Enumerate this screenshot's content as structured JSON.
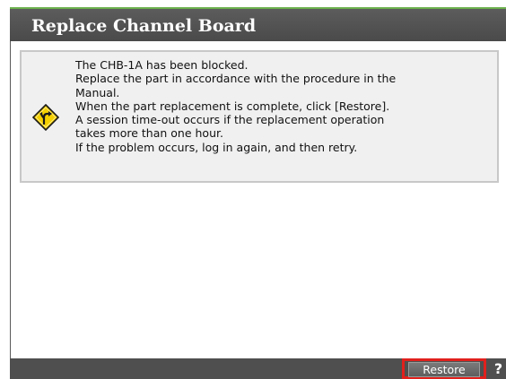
{
  "dialog": {
    "title": "Replace Channel Board"
  },
  "message": {
    "icon": "warning-diamond-icon",
    "lines": [
      "The CHB-1A has been blocked.",
      "Replace the part in accordance with the procedure in the",
      "Manual.",
      "When the part replacement is complete, click [Restore].",
      "A session time-out occurs if the replacement operation",
      "takes more than one hour.",
      "If the problem occurs, log in again, and then retry."
    ]
  },
  "footer": {
    "restore_label": "Restore",
    "help_label": "?"
  },
  "colors": {
    "title_bar": "#4f4f4f",
    "title_accent": "#6ab04c",
    "highlight": "#e0201c",
    "icon_yellow": "#f5d000"
  }
}
